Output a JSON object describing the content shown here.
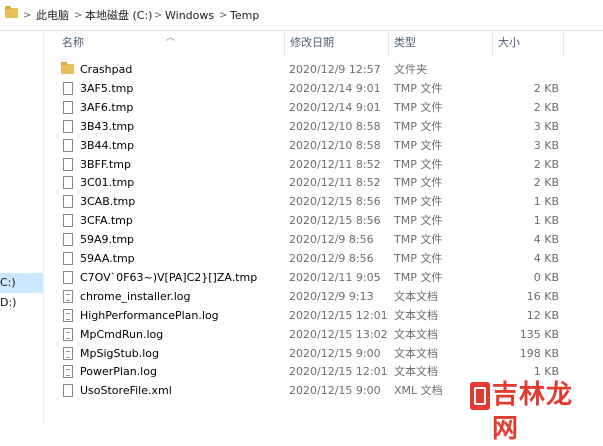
{
  "address": {
    "crumbs": [
      "此电脑",
      "本地磁盘 (C:)",
      "Windows",
      "Temp"
    ],
    "separator": ">"
  },
  "nav": {
    "drives": [
      "C:)",
      "D:)"
    ],
    "selected": "C:)"
  },
  "columns": {
    "name": "名称",
    "date": "修改日期",
    "type": "类型",
    "size": "大小"
  },
  "files": [
    {
      "name": "Crashpad",
      "date": "2020/12/9 12:57",
      "type": "文件夹",
      "size": "",
      "icon": "folder-icon"
    },
    {
      "name": "3AF5.tmp",
      "date": "2020/12/14 9:01",
      "type": "TMP 文件",
      "size": "2 KB",
      "icon": "file-icon"
    },
    {
      "name": "3AF6.tmp",
      "date": "2020/12/14 9:01",
      "type": "TMP 文件",
      "size": "2 KB",
      "icon": "file-icon"
    },
    {
      "name": "3B43.tmp",
      "date": "2020/12/10 8:58",
      "type": "TMP 文件",
      "size": "3 KB",
      "icon": "file-icon"
    },
    {
      "name": "3B44.tmp",
      "date": "2020/12/10 8:58",
      "type": "TMP 文件",
      "size": "3 KB",
      "icon": "file-icon"
    },
    {
      "name": "3BFF.tmp",
      "date": "2020/12/11 8:52",
      "type": "TMP 文件",
      "size": "2 KB",
      "icon": "file-icon"
    },
    {
      "name": "3C01.tmp",
      "date": "2020/12/11 8:52",
      "type": "TMP 文件",
      "size": "2 KB",
      "icon": "file-icon"
    },
    {
      "name": "3CAB.tmp",
      "date": "2020/12/15 8:56",
      "type": "TMP 文件",
      "size": "1 KB",
      "icon": "file-icon"
    },
    {
      "name": "3CFA.tmp",
      "date": "2020/12/15 8:56",
      "type": "TMP 文件",
      "size": "1 KB",
      "icon": "file-icon"
    },
    {
      "name": "59A9.tmp",
      "date": "2020/12/9 8:56",
      "type": "TMP 文件",
      "size": "4 KB",
      "icon": "file-icon"
    },
    {
      "name": "59AA.tmp",
      "date": "2020/12/9 8:56",
      "type": "TMP 文件",
      "size": "4 KB",
      "icon": "file-icon"
    },
    {
      "name": "C7OV`0F63~)V[PA]C2}[]ZA.tmp",
      "date": "2020/12/11 9:05",
      "type": "TMP 文件",
      "size": "0 KB",
      "icon": "file-icon"
    },
    {
      "name": "chrome_installer.log",
      "date": "2020/12/9 9:13",
      "type": "文本文档",
      "size": "16 KB",
      "icon": "text-file-icon"
    },
    {
      "name": "HighPerformancePlan.log",
      "date": "2020/12/15 12:01",
      "type": "文本文档",
      "size": "12 KB",
      "icon": "text-file-icon"
    },
    {
      "name": "MpCmdRun.log",
      "date": "2020/12/15 13:02",
      "type": "文本文档",
      "size": "135 KB",
      "icon": "text-file-icon"
    },
    {
      "name": "MpSigStub.log",
      "date": "2020/12/15 9:00",
      "type": "文本文档",
      "size": "198 KB",
      "icon": "text-file-icon"
    },
    {
      "name": "PowerPlan.log",
      "date": "2020/12/15 12:01",
      "type": "文本文档",
      "size": "1 KB",
      "icon": "text-file-icon"
    },
    {
      "name": "UsoStoreFile.xml",
      "date": "2020/12/15 9:00",
      "type": "XML 文档",
      "size": "",
      "icon": "file-icon"
    }
  ],
  "watermark": {
    "text": "吉林龙网",
    "color": "#e23b2f"
  }
}
